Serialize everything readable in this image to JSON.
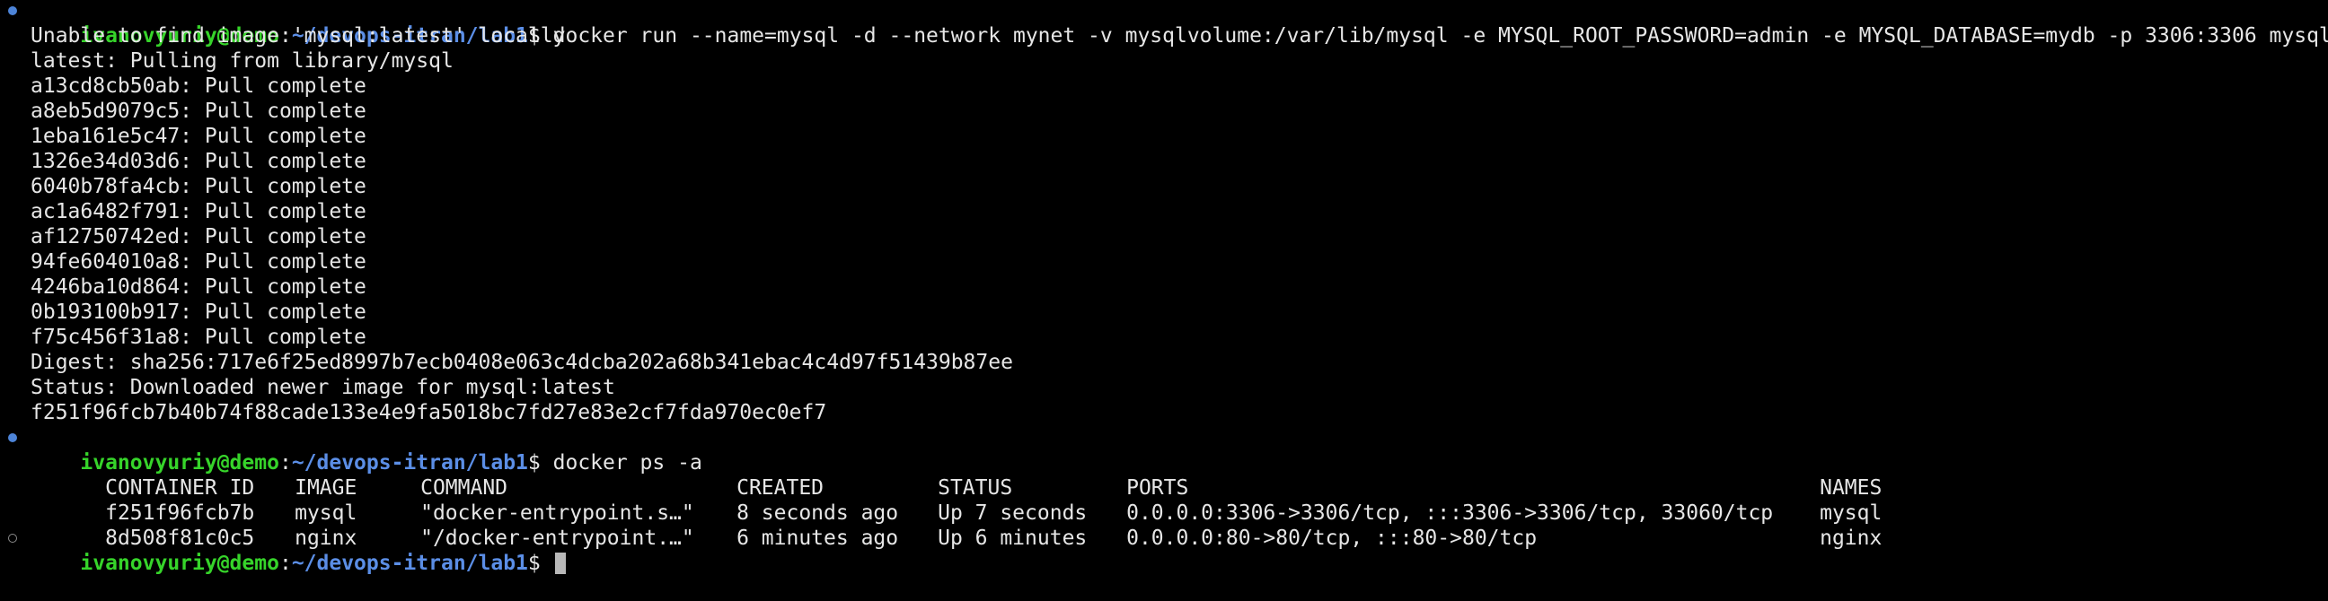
{
  "colors": {
    "background": "#000000",
    "text": "#e6e6e6",
    "user": "#36d42a",
    "path": "#5b8ee6",
    "marker_filled": "#4d84d8",
    "marker_hollow": "#8a8a8a",
    "cursor": "#b8b8b8"
  },
  "prompt1": {
    "user": "ivanovyuriy@demo",
    "path": "~/devops-itran/lab1",
    "command": "docker run --name=mysql -d --network mynet -v mysqlvolume:/var/lib/mysql -e MYSQL_ROOT_PASSWORD=admin -e MYSQL_DATABASE=mydb -p 3306:3306 mysql",
    "marker_icon": "filled-dot-icon"
  },
  "output1": [
    "Unable to find image 'mysql:latest' locally",
    "latest: Pulling from library/mysql",
    "a13cd8cb50ab: Pull complete",
    "a8eb5d9079c5: Pull complete",
    "1eba161e5c47: Pull complete",
    "1326e34d03d6: Pull complete",
    "6040b78fa4cb: Pull complete",
    "ac1a6482f791: Pull complete",
    "af12750742ed: Pull complete",
    "94fe604010a8: Pull complete",
    "4246ba10d864: Pull complete",
    "0b193100b917: Pull complete",
    "f75c456f31a8: Pull complete",
    "Digest: sha256:717e6f25ed8997b7ecb0408e063c4dcba202a68b341ebac4c4d97f51439b87ee",
    "Status: Downloaded newer image for mysql:latest",
    "f251f96fcb7b40b74f88cade133e4e9fa5018bc7fd27e83e2cf7fda970ec0ef7"
  ],
  "prompt2": {
    "user": "ivanovyuriy@demo",
    "path": "~/devops-itran/lab1",
    "command": "docker ps -a",
    "marker_icon": "filled-dot-icon"
  },
  "ps_table": {
    "headers": [
      "CONTAINER ID",
      "IMAGE",
      "COMMAND",
      "CREATED",
      "STATUS",
      "PORTS",
      "NAMES"
    ],
    "rows": [
      [
        "f251f96fcb7b",
        "mysql",
        "\"docker-entrypoint.s…\"",
        "8 seconds ago",
        "Up 7 seconds",
        "0.0.0.0:3306->3306/tcp, :::3306->3306/tcp, 33060/tcp",
        "mysql"
      ],
      [
        "8d508f81c0c5",
        "nginx",
        "\"/docker-entrypoint.…\"",
        "6 minutes ago",
        "Up 6 minutes",
        "0.0.0.0:80->80/tcp, :::80->80/tcp",
        "nginx"
      ]
    ]
  },
  "prompt3": {
    "user": "ivanovyuriy@demo",
    "path": "~/devops-itran/lab1",
    "command": "",
    "marker_icon": "hollow-dot-icon"
  }
}
